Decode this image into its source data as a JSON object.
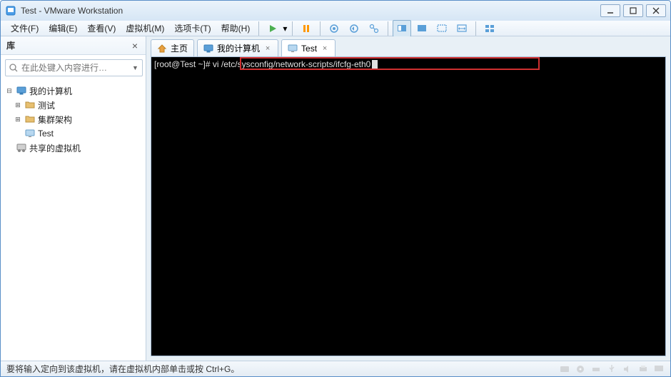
{
  "window": {
    "title": "Test - VMware Workstation"
  },
  "menu": {
    "file": "文件(F)",
    "edit": "编辑(E)",
    "view": "查看(V)",
    "vm": "虚拟机(M)",
    "tabs": "选项卡(T)",
    "help": "帮助(H)"
  },
  "sidebar": {
    "title": "库",
    "search_placeholder": "在此处键入内容进行…",
    "tree": {
      "root": "我的计算机",
      "node1": "测试",
      "node2": "集群架构",
      "node3": "Test",
      "shared": "共享的虚拟机"
    }
  },
  "tabs": {
    "home": "主页",
    "mycomputer": "我的计算机",
    "test": "Test"
  },
  "terminal": {
    "prompt": "[root@Test ~]# ",
    "command": "vi /etc/sysconfig/network-scripts/ifcfg-eth0"
  },
  "statusbar": {
    "text": "要将输入定向到该虚拟机，请在虚拟机内部单击或按 Ctrl+G。"
  }
}
